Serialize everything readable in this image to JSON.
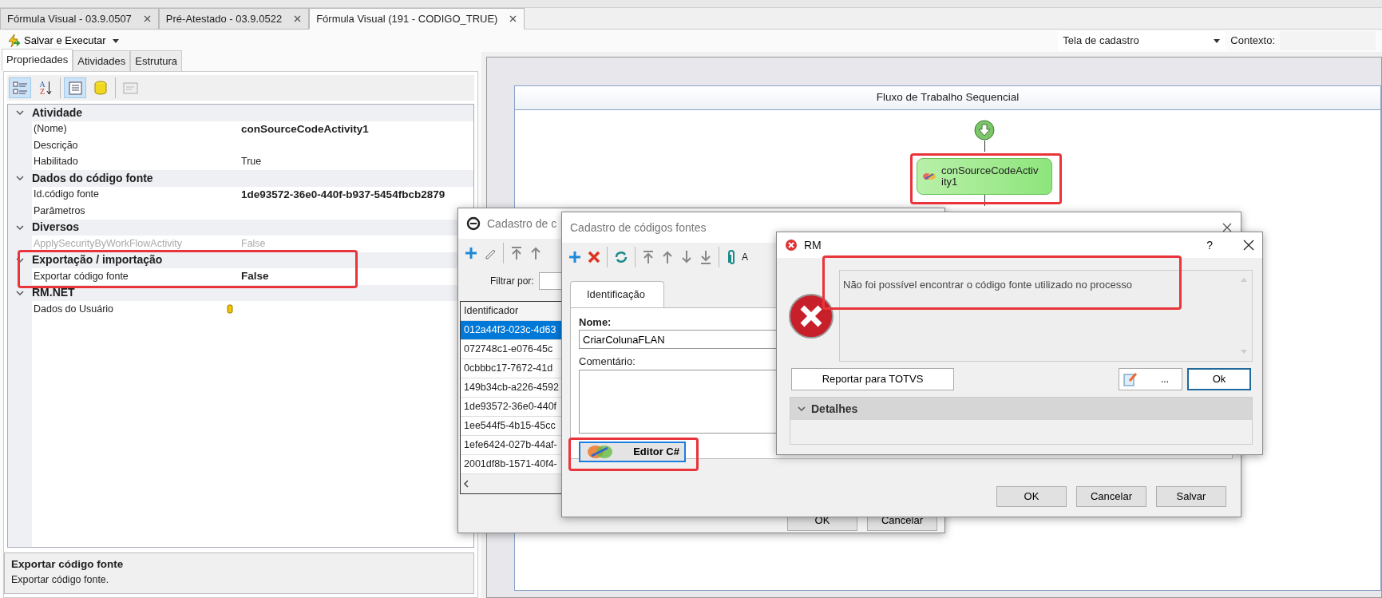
{
  "doc_tabs": [
    {
      "label": "Fórmula Visual - 03.9.0507",
      "selected": false
    },
    {
      "label": "Pré-Atestado - 03.9.0522",
      "selected": false
    },
    {
      "label": "Fórmula Visual (191 - CODIGO_TRUE)",
      "selected": true
    }
  ],
  "sort_icon_letters": [
    "A",
    "Z"
  ],
  "toolbar": {
    "run_button": "Salvar e Executar",
    "screen_select": "Tela de cadastro",
    "context_label": "Contexto:"
  },
  "panel_tabs": [
    {
      "label": "Propriedades",
      "selected": true
    },
    {
      "label": "Atividades",
      "selected": false
    },
    {
      "label": "Estrutura",
      "selected": false
    }
  ],
  "property_groups": [
    {
      "title": "Atividade",
      "expanded": true,
      "properties": [
        {
          "name": "(Nome)",
          "value": "conSourceCodeActivity1",
          "modified": true,
          "disabled": false,
          "kind": "text"
        },
        {
          "name": "Descrição",
          "disabled": false,
          "kind": "text"
        },
        {
          "name": "Habilitado",
          "value": "True",
          "modified": false,
          "disabled": false,
          "kind": "text"
        }
      ]
    },
    {
      "title": "Dados do código fonte",
      "expanded": true,
      "properties": [
        {
          "name": "Id.código fonte",
          "value": "1de93572-36e0-440f-b937-5454fbcb2879",
          "modified": true,
          "disabled": false,
          "kind": "text"
        },
        {
          "name": "Parâmetros",
          "disabled": false,
          "kind": "text"
        }
      ]
    },
    {
      "title": "Diversos",
      "expanded": true,
      "properties": [
        {
          "name": "ApplySecurityByWorkFlowActivity",
          "value": "False",
          "modified": false,
          "disabled": true,
          "kind": "text"
        }
      ]
    },
    {
      "title": "Exportação / importação",
      "expanded": true,
      "properties": [
        {
          "name": "Exportar código fonte",
          "value": "False",
          "modified": true,
          "disabled": false,
          "kind": "text"
        }
      ]
    },
    {
      "title": "RM.NET",
      "expanded": true,
      "properties": [
        {
          "name": "Dados do Usuário",
          "disabled": false,
          "kind": "collection"
        }
      ]
    }
  ],
  "description": {
    "title": "Exportar código fonte",
    "text": "Exportar código fonte."
  },
  "workflow": {
    "title": "Fluxo de Trabalho Sequencial",
    "activity": "conSourceCodeActivity1"
  },
  "list_dialog": {
    "title": "Cadastro de c",
    "filter_label": "Filtrar por:",
    "column": "Identificador",
    "rows": [
      {
        "text": "012a44f3-023c-4d63",
        "selected": true
      },
      {
        "text": "072748c1-e076-45c",
        "selected": false
      },
      {
        "text": "0cbbbc17-7672-41d",
        "selected": false
      },
      {
        "text": "149b34cb-a226-4592",
        "selected": false
      },
      {
        "text": "1de93572-36e0-440f",
        "selected": false
      },
      {
        "text": "1ee544f5-4b15-45cc",
        "selected": false
      },
      {
        "text": "1efe6424-027b-44af-",
        "selected": false
      },
      {
        "text": "2001df8b-1571-40f4-",
        "selected": false
      }
    ],
    "buttons": [
      "OK",
      "Cancelar"
    ]
  },
  "source_dialog": {
    "title": "Cadastro de códigos fontes",
    "attach_label": "A",
    "tab": "Identificação",
    "name_label": "Nome:",
    "name_value": "CriarColunaFLAN",
    "comment_label": "Comentário:",
    "editor_button": "Editor C#",
    "buttons": [
      "OK",
      "Cancelar",
      "Salvar"
    ]
  },
  "error_dialog": {
    "title": "RM",
    "help": "?",
    "message": "Não foi possível encontrar o código fonte utilizado no processo",
    "report_button": "Reportar para TOTVS",
    "more_button": "...",
    "ok_button": "Ok",
    "details": {
      "label": "Detalhes",
      "expanded": false
    }
  }
}
